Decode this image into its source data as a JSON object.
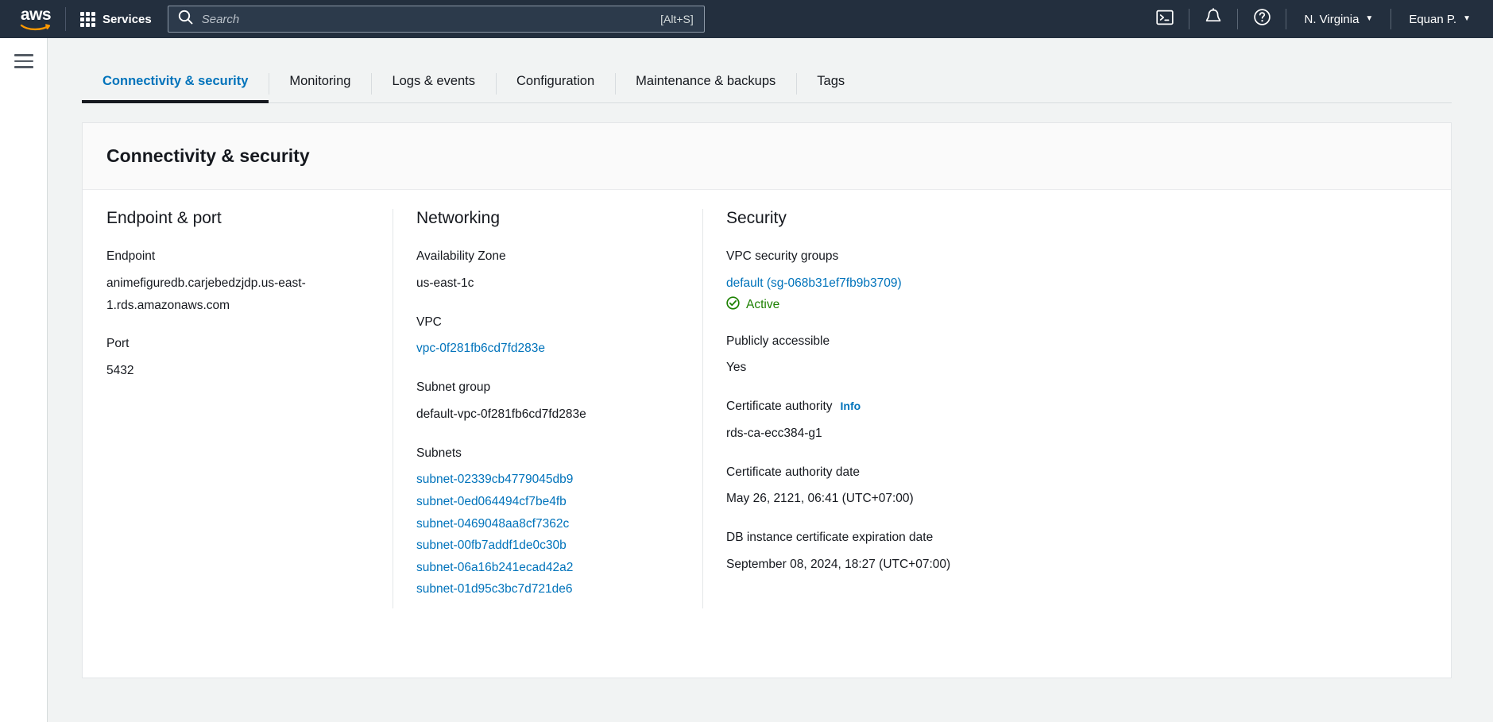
{
  "topnav": {
    "logo_alt": "aws",
    "services_label": "Services",
    "search_placeholder": "Search",
    "search_value": "",
    "search_shortcut": "[Alt+S]",
    "cloudshell_icon": "cloudshell-icon",
    "notifications_icon": "bell-icon",
    "help_icon": "question-circle-icon",
    "region_label": "N. Virginia",
    "account_label": "Equan P.",
    "caret": "▼"
  },
  "sidebar": {
    "menu_icon": "hamburger-icon"
  },
  "tabs": [
    {
      "label": "Connectivity & security",
      "active": true
    },
    {
      "label": "Monitoring",
      "active": false
    },
    {
      "label": "Logs & events",
      "active": false
    },
    {
      "label": "Configuration",
      "active": false
    },
    {
      "label": "Maintenance & backups",
      "active": false
    },
    {
      "label": "Tags",
      "active": false
    }
  ],
  "card": {
    "title": "Connectivity & security"
  },
  "endpoint_port": {
    "heading": "Endpoint & port",
    "endpoint_label": "Endpoint",
    "endpoint_value": "animefiguredb.carjebedzjdp.us-east-1.rds.amazonaws.com",
    "port_label": "Port",
    "port_value": "5432"
  },
  "networking": {
    "heading": "Networking",
    "az_label": "Availability Zone",
    "az_value": "us-east-1c",
    "vpc_label": "VPC",
    "vpc_value": "vpc-0f281fb6cd7fd283e",
    "subnet_group_label": "Subnet group",
    "subnet_group_value": "default-vpc-0f281fb6cd7fd283e",
    "subnets_label": "Subnets",
    "subnets": [
      "subnet-02339cb4779045db9",
      "subnet-0ed064494cf7be4fb",
      "subnet-0469048aa8cf7362c",
      "subnet-00fb7addf1de0c30b",
      "subnet-06a16b241ecad42a2",
      "subnet-01d95c3bc7d721de6"
    ]
  },
  "security": {
    "heading": "Security",
    "sg_label": "VPC security groups",
    "sg_value": "default (sg-068b31ef7fb9b3709)",
    "sg_status": "Active",
    "sg_status_icon": "check-circle-icon",
    "public_label": "Publicly accessible",
    "public_value": "Yes",
    "ca_label": "Certificate authority",
    "ca_info_label": "Info",
    "ca_value": "rds-ca-ecc384-g1",
    "ca_date_label": "Certificate authority date",
    "ca_date_value": "May 26, 2121, 06:41 (UTC+07:00)",
    "cert_exp_label": "DB instance certificate expiration date",
    "cert_exp_value": "September 08, 2024, 18:27 (UTC+07:00)"
  },
  "colors": {
    "nav_bg": "#232f3e",
    "link": "#0073bb",
    "active_tab": "#0073bb",
    "status_green": "#1d8102",
    "page_bg": "#f1f3f3"
  }
}
